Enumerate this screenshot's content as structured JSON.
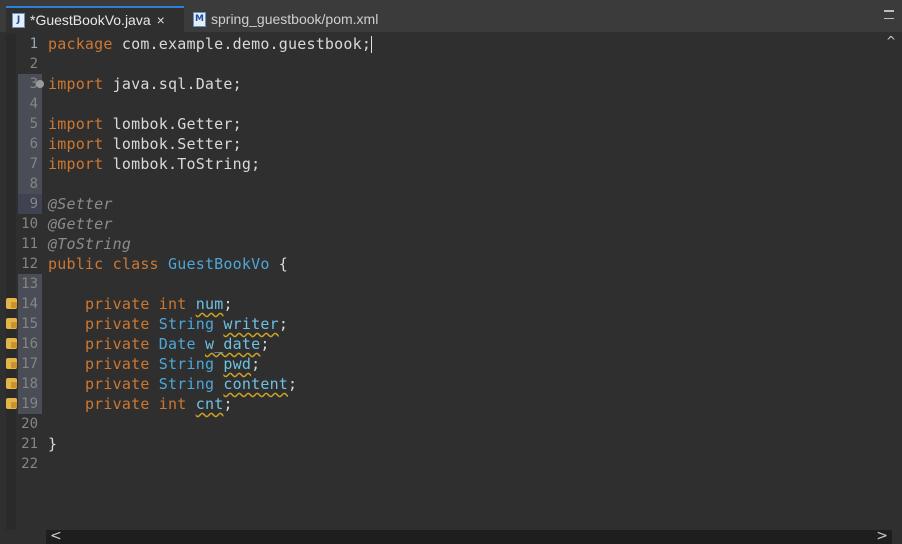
{
  "tabs": [
    {
      "label": "*GuestBookVo.java",
      "icon": "java-file-icon",
      "icon_text": "J",
      "active": true
    },
    {
      "label": "spring_guestbook/pom.xml",
      "icon": "maven-file-icon",
      "icon_text": "M",
      "active": false
    }
  ],
  "tab_close_glyph": "×",
  "lines": [
    {
      "n": "1",
      "text": "package com.example.demo.guestbook;"
    },
    {
      "n": "2",
      "text": ""
    },
    {
      "n": "3",
      "text": "import java.sql.Date;"
    },
    {
      "n": "4",
      "text": ""
    },
    {
      "n": "5",
      "text": "import lombok.Getter;"
    },
    {
      "n": "6",
      "text": "import lombok.Setter;"
    },
    {
      "n": "7",
      "text": "import lombok.ToString;"
    },
    {
      "n": "8",
      "text": ""
    },
    {
      "n": "9",
      "text": "@Setter"
    },
    {
      "n": "10",
      "text": "@Getter"
    },
    {
      "n": "11",
      "text": "@ToString"
    },
    {
      "n": "12",
      "text": "public class GuestBookVo {"
    },
    {
      "n": "13",
      "text": ""
    },
    {
      "n": "14",
      "text": "    private int num;"
    },
    {
      "n": "15",
      "text": "    private String writer;"
    },
    {
      "n": "16",
      "text": "    private Date w_date;"
    },
    {
      "n": "17",
      "text": "    private String pwd;"
    },
    {
      "n": "18",
      "text": "    private String content;"
    },
    {
      "n": "19",
      "text": "    private int cnt;"
    },
    {
      "n": "20",
      "text": ""
    },
    {
      "n": "21",
      "text": "}"
    },
    {
      "n": "22",
      "text": ""
    }
  ],
  "tokens": {
    "package": "package",
    "pkg_name": "com.example.demo.guestbook;",
    "import": "import",
    "imp_date": "java.sql.Date;",
    "imp_getter": "lombok.Getter;",
    "imp_setter": "lombok.Setter;",
    "imp_tostring": "lombok.ToString;",
    "ann_setter": "@Setter",
    "ann_getter": "@Getter",
    "ann_tostring": "@ToString",
    "public": "public",
    "class": "class",
    "class_name": "GuestBookVo",
    "open_brace": "{",
    "close_brace": "}",
    "private": "private",
    "int": "int",
    "String": "String",
    "Date": "Date",
    "f_num": "num",
    "f_writer": "writer",
    "f_w_date": "w_date",
    "f_pwd": "pwd",
    "f_content": "content",
    "f_cnt": "cnt",
    "semi": ";"
  },
  "scroll_glyphs": {
    "left": "<",
    "right": ">",
    "up": "^"
  },
  "colors": {
    "keyword": "#cc7832",
    "type": "#4ea6d8",
    "field": "#6ec1e4",
    "annotation": "#8c8c8c",
    "active_tab_border": "#2e7fd8"
  }
}
